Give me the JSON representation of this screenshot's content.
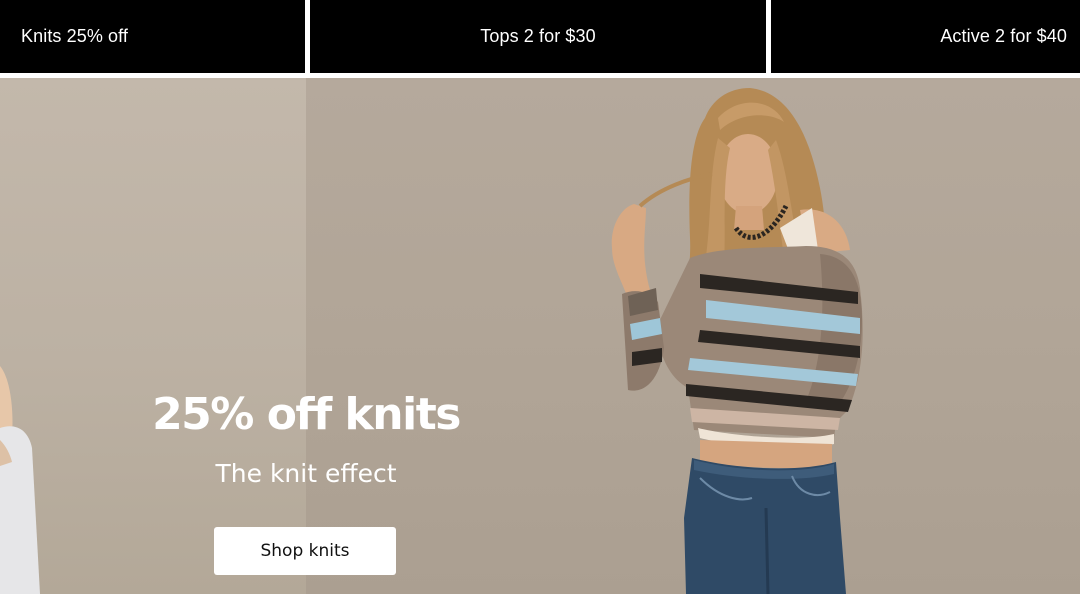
{
  "promo_tabs": [
    {
      "label": "Knits 25% off"
    },
    {
      "label": "Tops 2 for $30"
    },
    {
      "label": "Active 2 for $40"
    }
  ],
  "hero": {
    "headline": "25% off knits",
    "subheadline": "The knit effect",
    "cta_label": "Shop knits",
    "image_alt": "Model in striped off-shoulder knit sweater and blue jeans"
  },
  "colors": {
    "promo_background": "#000000",
    "promo_text": "#ffffff",
    "hero_background": "#b1a597",
    "cta_background": "#ffffff",
    "cta_text": "#111111"
  }
}
